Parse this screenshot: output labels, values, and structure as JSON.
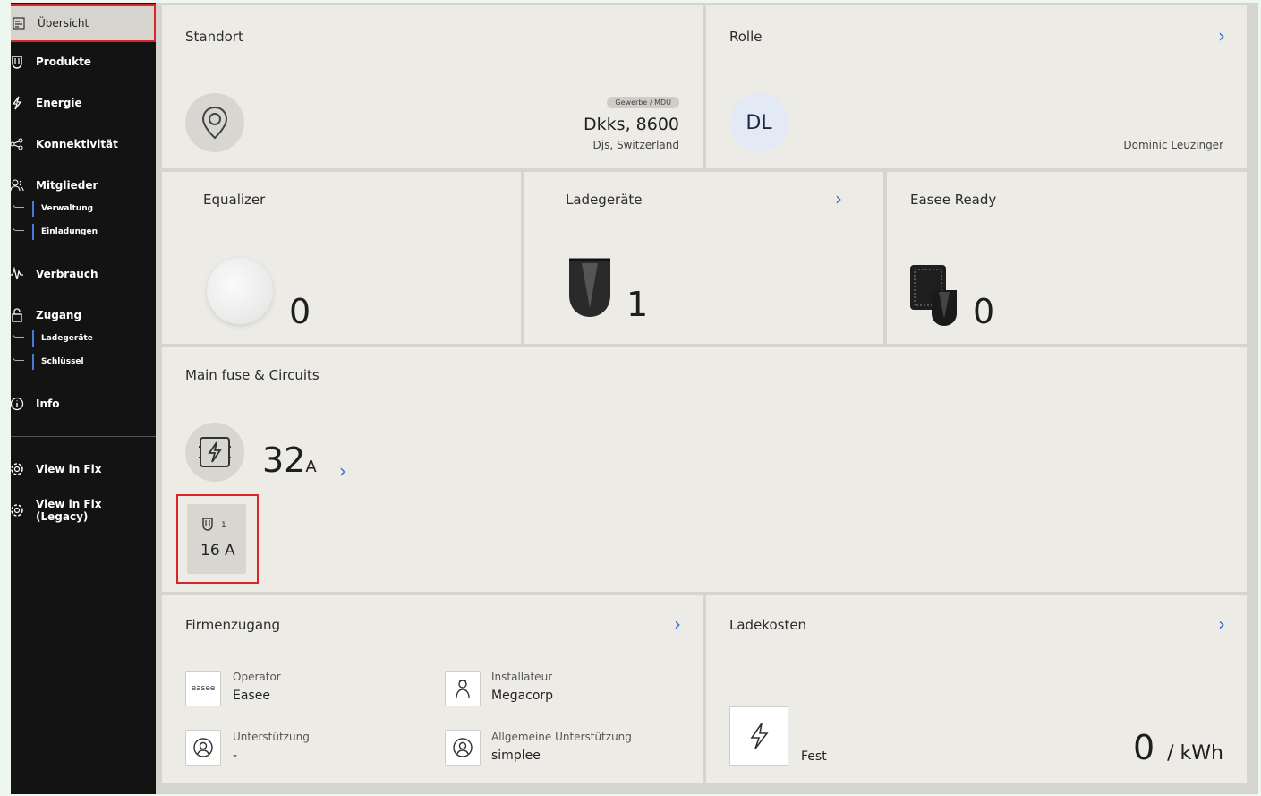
{
  "sidebar": {
    "items": [
      {
        "label": "Übersicht",
        "icon": "overview-icon"
      },
      {
        "label": "Produkte",
        "icon": "product-icon"
      },
      {
        "label": "Energie",
        "icon": "lightning-icon"
      },
      {
        "label": "Konnektivität",
        "icon": "network-icon"
      },
      {
        "label": "Mitglieder",
        "icon": "members-icon"
      },
      {
        "label": "Verbrauch",
        "icon": "consumption-icon"
      },
      {
        "label": "Zugang",
        "icon": "lock-icon"
      },
      {
        "label": "Info",
        "icon": "info-icon"
      },
      {
        "label": "View in Fix",
        "icon": "gear-icon"
      },
      {
        "label": "View in Fix (Legacy)",
        "icon": "gear-icon"
      }
    ],
    "sub_mitglieder": [
      "Verwaltung",
      "Einladungen"
    ],
    "sub_zugang": [
      "Ladegeräte",
      "Schlüssel"
    ]
  },
  "standort": {
    "title": "Standort",
    "badge": "Gewerbe / MDU",
    "name": "Dkks, 8600",
    "location": "Djs, Switzerland"
  },
  "rolle": {
    "title": "Rolle",
    "initials": "DL",
    "user": "Dominic Leuzinger"
  },
  "equalizer": {
    "title": "Equalizer",
    "count": "0"
  },
  "ladegeraete": {
    "title": "Ladegeräte",
    "count": "1"
  },
  "easee_ready": {
    "title": "Easee Ready",
    "count": "0"
  },
  "main_fuse": {
    "title": "Main fuse & Circuits",
    "value": "32",
    "unit": "A",
    "circuit_num": "1",
    "circuit_value": "16 A"
  },
  "firmenzugang": {
    "title": "Firmenzugang",
    "operator": {
      "label": "Operator",
      "value": "Easee",
      "logo_text": "easee"
    },
    "installateur": {
      "label": "Installateur",
      "value": "Megacorp"
    },
    "unterstuetzung": {
      "label": "Unterstützung",
      "value": "-"
    },
    "allgemeine": {
      "label": "Allgemeine Unterstützung",
      "value": "simplee"
    }
  },
  "ladekosten": {
    "title": "Ladekosten",
    "type": "Fest",
    "value": "0",
    "unit": "/ kWh"
  },
  "colors": {
    "accent": "#2f6fd6",
    "highlight": "#d9262b",
    "sidebar": "#131313"
  }
}
